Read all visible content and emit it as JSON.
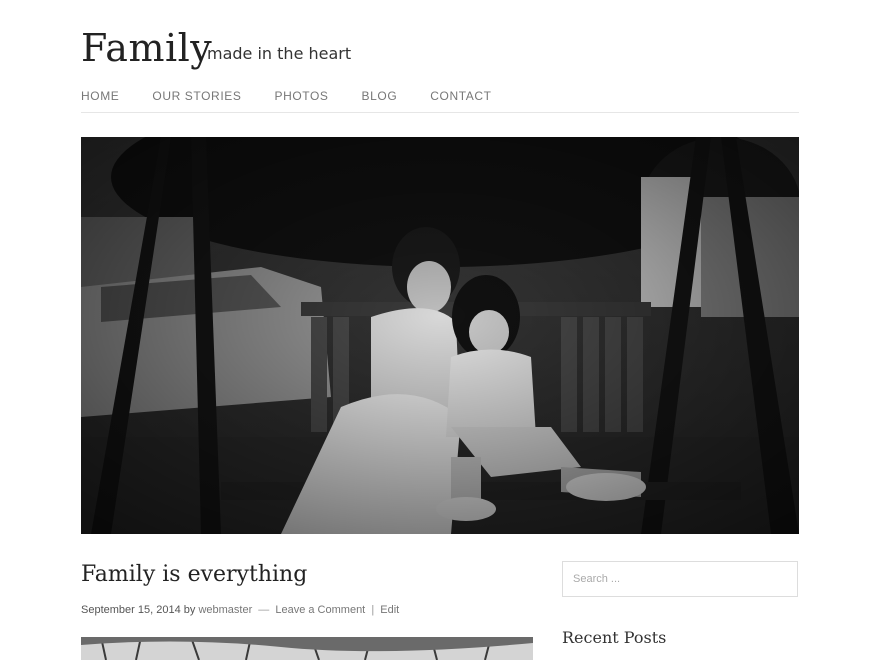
{
  "site": {
    "title": "Family",
    "tagline": "made in the heart"
  },
  "nav": {
    "items": [
      {
        "label": "HOME"
      },
      {
        "label": "OUR STORIES"
      },
      {
        "label": "PHOTOS"
      },
      {
        "label": "BLOG"
      },
      {
        "label": "CONTACT"
      }
    ]
  },
  "post": {
    "title": "Family is everything",
    "date": "September 15, 2014",
    "by": "by",
    "author": "webmaster",
    "dash": "—",
    "comment_link": "Leave a Comment",
    "pipe": "|",
    "edit_link": "Edit"
  },
  "sidebar": {
    "search_placeholder": "Search ...",
    "recent_posts_title": "Recent Posts"
  },
  "colors": {
    "text": "#333333",
    "nav": "#777777",
    "border": "#e6e6e6"
  }
}
